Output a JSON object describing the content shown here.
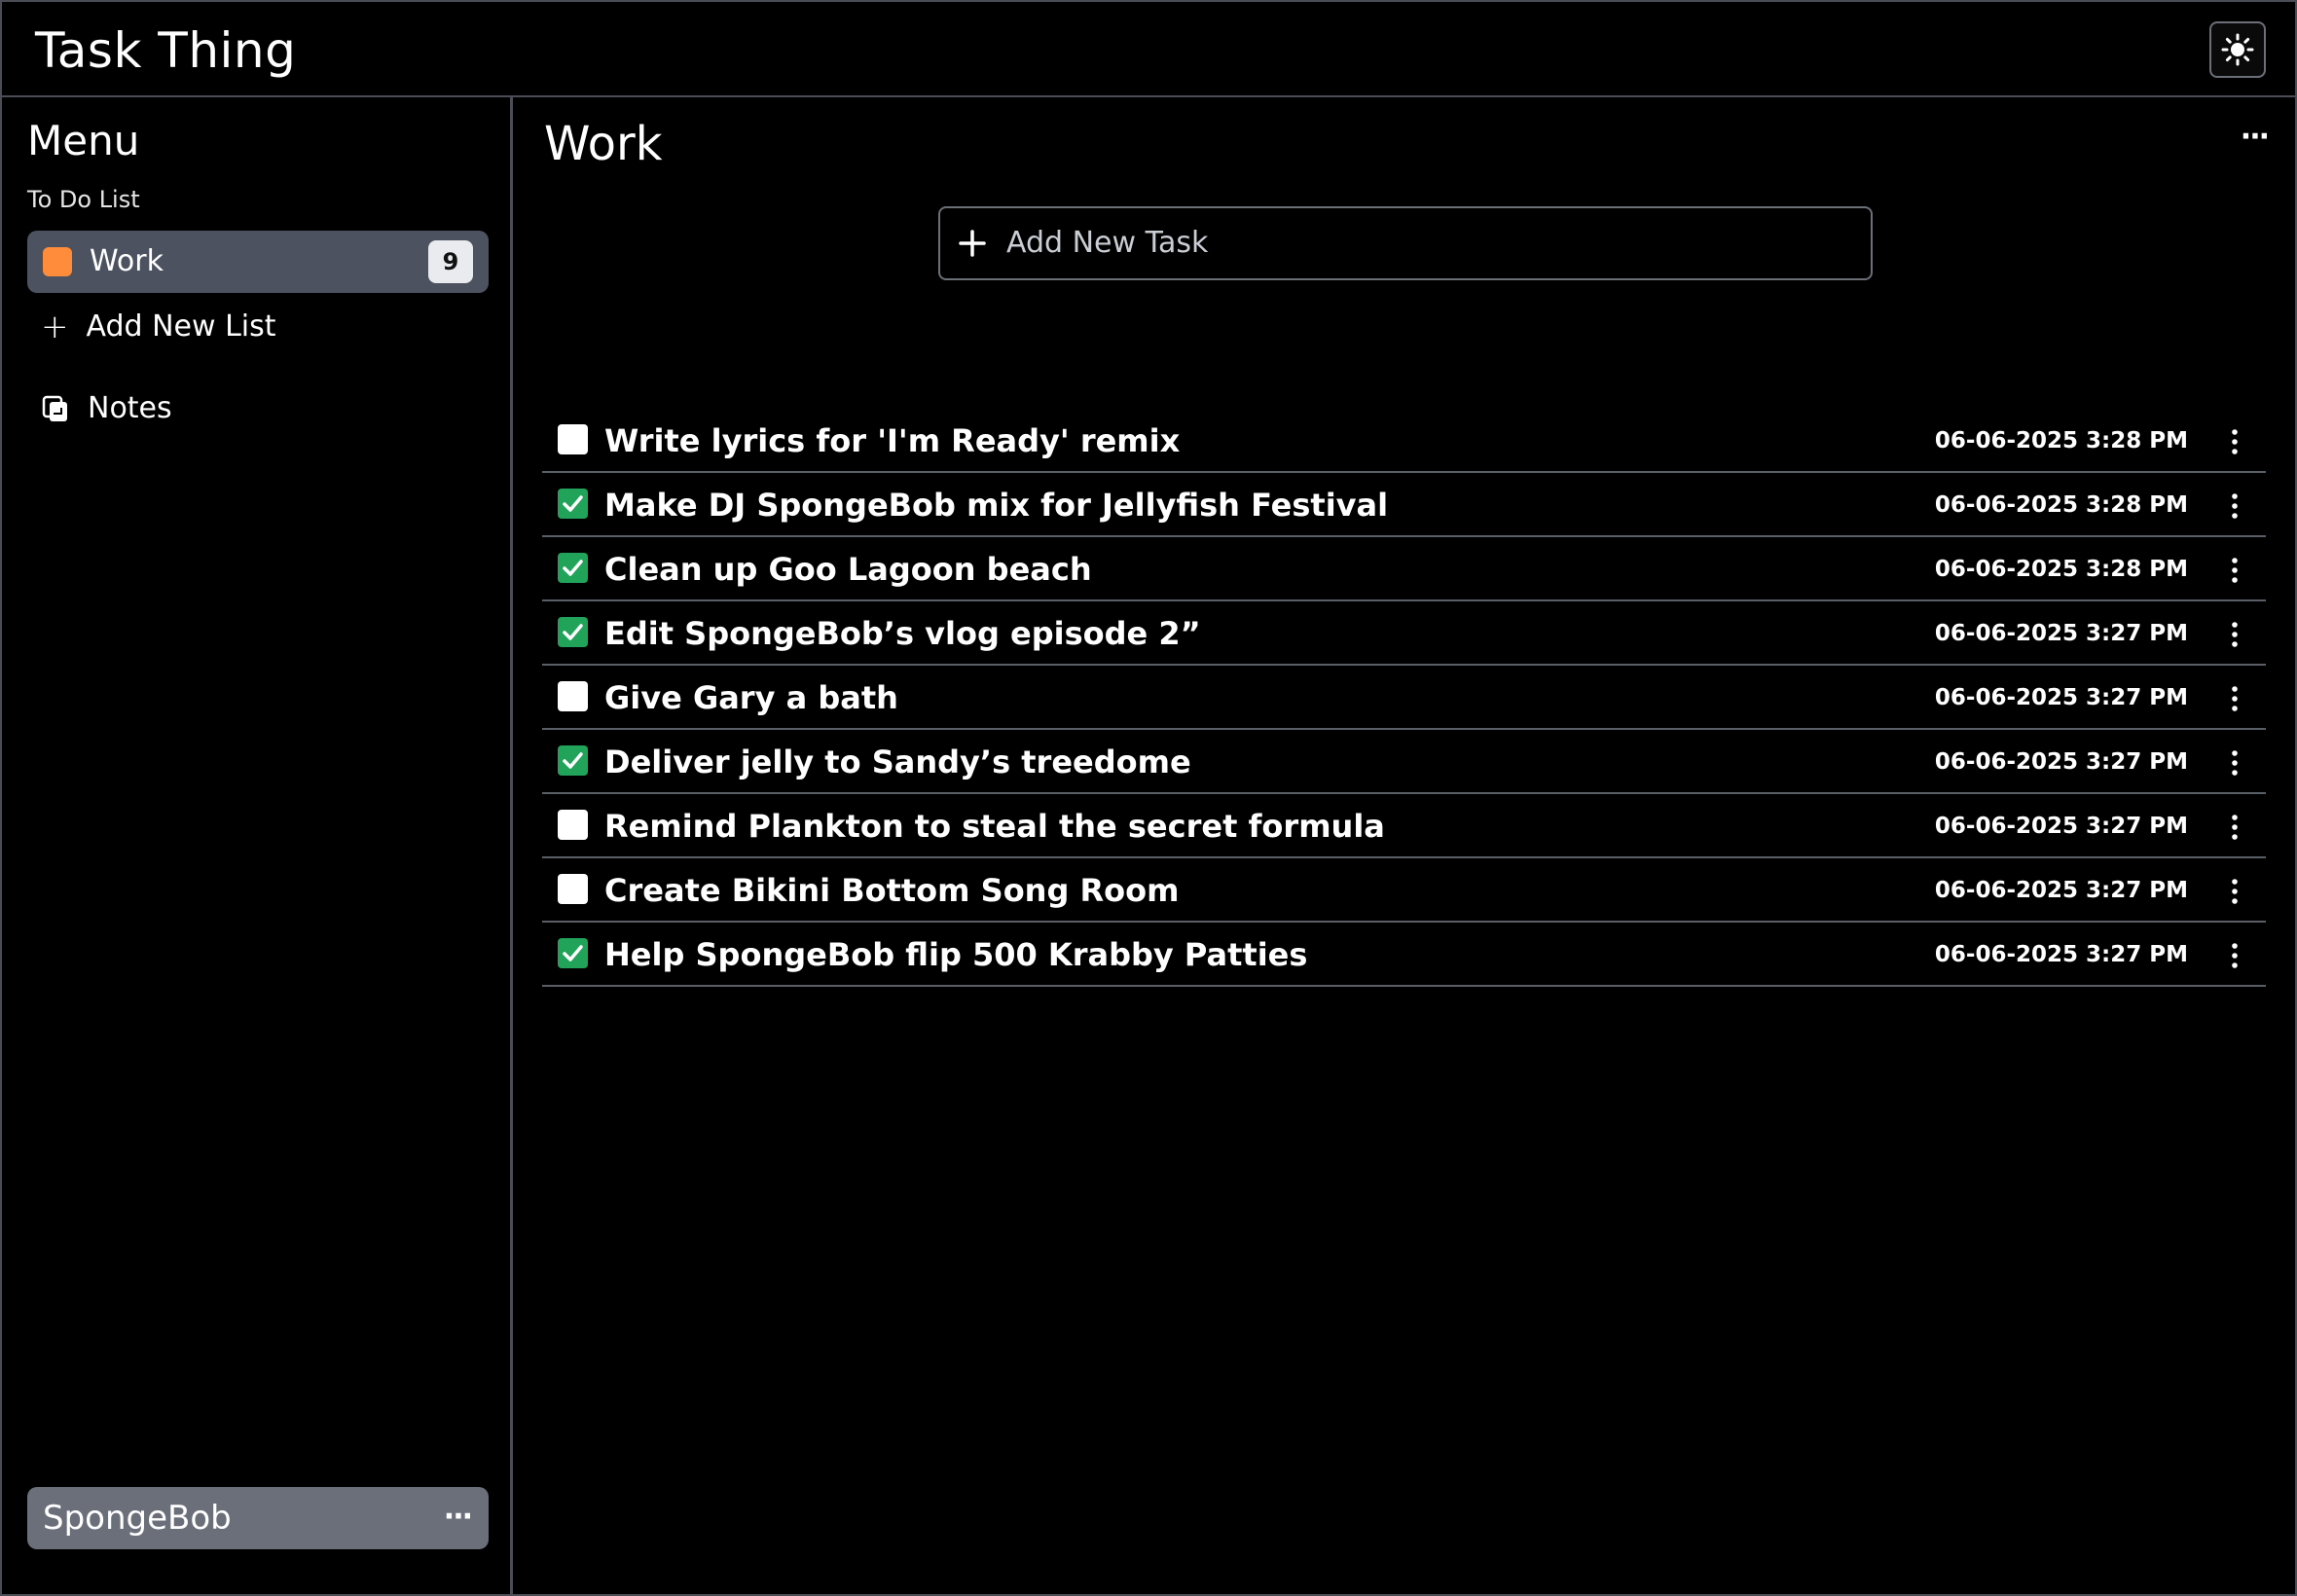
{
  "app": {
    "title": "Task Thing"
  },
  "sidebar": {
    "title": "Menu",
    "section_label": "To Do List",
    "lists": [
      {
        "label": "Work",
        "count": "9",
        "color": "#ff8c3b"
      }
    ],
    "add_list_label": "Add New List",
    "notes_label": "Notes",
    "user": {
      "name": "SpongeBob",
      "more": "···"
    }
  },
  "main": {
    "title": "Work",
    "more": "···",
    "add_task_placeholder": "Add New Task",
    "tasks": [
      {
        "title": "Write lyrics for 'I'm Ready' remix",
        "date": "06-06-2025 3:28 PM",
        "done": false
      },
      {
        "title": "Make DJ SpongeBob mix for Jellyfish Festival",
        "date": "06-06-2025 3:28 PM",
        "done": true
      },
      {
        "title": "Clean up Goo Lagoon beach",
        "date": "06-06-2025 3:28 PM",
        "done": true
      },
      {
        "title": "Edit SpongeBob’s vlog episode 2”",
        "date": "06-06-2025 3:27 PM",
        "done": true
      },
      {
        "title": "Give Gary a bath",
        "date": "06-06-2025 3:27 PM",
        "done": false
      },
      {
        "title": "Deliver jelly to Sandy’s treedome",
        "date": "06-06-2025 3:27 PM",
        "done": true
      },
      {
        "title": "Remind Plankton to steal the secret formula",
        "date": "06-06-2025 3:27 PM",
        "done": false
      },
      {
        "title": "Create Bikini Bottom Song Room",
        "date": "06-06-2025 3:27 PM",
        "done": false
      },
      {
        "title": "Help SpongeBob flip 500 Krabby Patties",
        "date": "06-06-2025 3:27 PM",
        "done": true
      }
    ]
  },
  "colors": {
    "accent_check": "#21a35a",
    "list_bg": "#4c5260",
    "user_bg": "#6a6f7a"
  }
}
